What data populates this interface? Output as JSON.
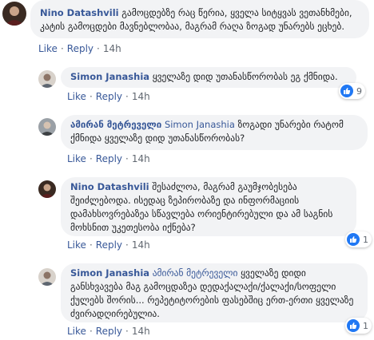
{
  "comments": [
    {
      "author": "Nino Datashvili",
      "text": "გამოცდებზე რაც წერია, ყველა სიტყვას ვეთანხმები, კატის გამოცდები მავნებლობაა, მაგრამ რაღა ზოგად უნარებს ეცხებ.",
      "actions": {
        "like": "Like",
        "reply": "Reply",
        "time": "14h"
      }
    },
    {
      "author": "Simon Janashia",
      "text": "ყველაზე დიდ უთანასწორობას ეგ ქმნიდა.",
      "actions": {
        "like": "Like",
        "reply": "Reply",
        "time": "14h"
      },
      "reactions": {
        "icon": "like-icon",
        "count": "9"
      }
    },
    {
      "author": "ამირან მეტრეველი",
      "reply_to": "Simon Janashia",
      "text": "ზოგადი უნარები რატომ ქმნიდა ყველაზე დიდ უთანასწორობას?",
      "actions": {
        "like": "Like",
        "reply": "Reply",
        "time": "14h"
      }
    },
    {
      "author": "Nino Datashvili",
      "text": "შესაძლოა, მაგრამ გაუმჯობესება შეიძლებოდა. ისედაც ზეპირობაზე და ინფორმაციის დამახსოვრებაზეა სწავლება ორიენტირებული და ამ საგნის მოხსნით უკეთესობა იქნება?",
      "actions": {
        "like": "Like",
        "reply": "Reply",
        "time": "14h"
      },
      "reactions": {
        "icon": "like-icon",
        "count": "1"
      }
    },
    {
      "author": "Simon Janashia",
      "reply_to": "ამირან მეტრეველი",
      "text": "ყველაზე დიდი განსხვავება მაგ გამოცდაზეა დედაქალაქი/ქალაქი/სოფელი ქულებს შორის... რეპეტიტორების ფასებშიც ერთ-ერთი ყველაზე ძვირადღირებულია.",
      "actions": {
        "like": "Like",
        "reply": "Reply",
        "time": "14h"
      },
      "reactions": {
        "icon": "like-icon",
        "count": "1"
      }
    }
  ],
  "colors": {
    "link": "#385898",
    "bubble": "#f2f3f5",
    "like": "#2078f4"
  }
}
